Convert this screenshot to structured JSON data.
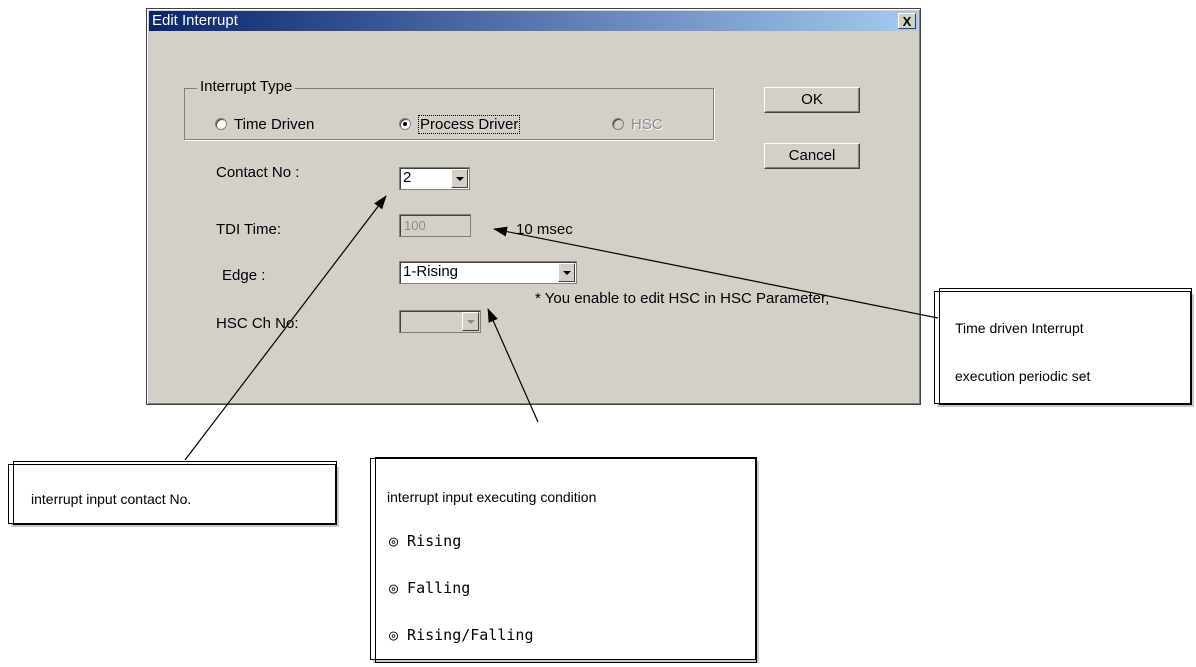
{
  "dialog": {
    "title": "Edit Interrupt",
    "close_label": "X",
    "interrupt_type": {
      "legend": "Interrupt Type",
      "options": [
        {
          "label": "Time Driven",
          "checked": false,
          "enabled": true
        },
        {
          "label": "Process Driver",
          "checked": true,
          "enabled": true
        },
        {
          "label": "HSC",
          "checked": false,
          "enabled": false
        }
      ]
    },
    "ok_label": "OK",
    "cancel_label": "Cancel",
    "contact_no": {
      "label": "Contact No :",
      "value": "2"
    },
    "tdi_time": {
      "label": "TDI Time:",
      "value": "100",
      "unit": "10 msec"
    },
    "edge": {
      "label": "Edge :",
      "value": "1-Rising"
    },
    "hsc_ch_no": {
      "label": "HSC Ch No:",
      "value": ""
    },
    "hsc_note": "* You enable to edit HSC in HSC Parameter,"
  },
  "callouts": {
    "contact": "interrupt input contact No.",
    "condition": {
      "title": "interrupt input executing condition",
      "items": [
        "◎ Rising",
        "◎ Falling",
        "◎ Rising/Falling"
      ]
    },
    "time_driven": {
      "line1": "Time driven Interrupt",
      "line2": "execution periodic set"
    }
  }
}
